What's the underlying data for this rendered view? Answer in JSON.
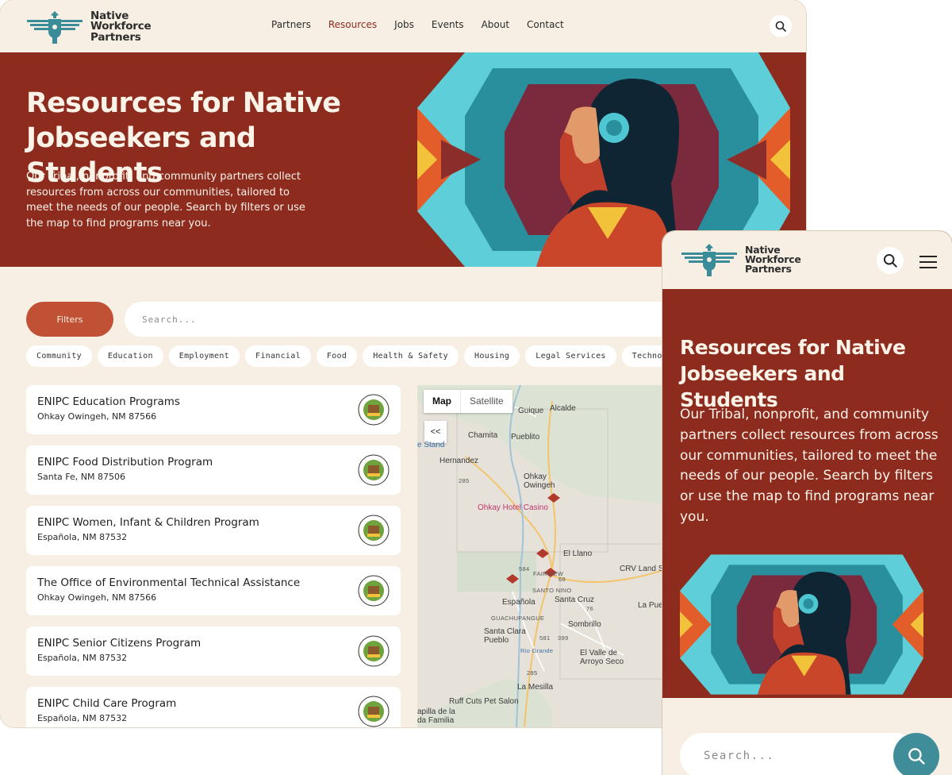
{
  "brand": {
    "name_line1": "Native",
    "name_line2": "Workforce",
    "name_line3": "Partners"
  },
  "nav": {
    "items": [
      "Partners",
      "Resources",
      "Jobs",
      "Events",
      "About",
      "Contact"
    ],
    "active": "Resources"
  },
  "hero": {
    "title": "Resources for Native Jobseekers and Students",
    "description": "Our Tribal, nonprofit, and community partners collect resources from across our communities, tailored to meet the needs of our people. Search by filters or use the map to find programs near you."
  },
  "filters": {
    "button_label": "Filters",
    "search_placeholder": "Search..."
  },
  "categories": [
    "Community",
    "Education",
    "Employment",
    "Financial",
    "Food",
    "Health & Safety",
    "Housing",
    "Legal Services",
    "Technology"
  ],
  "resources": [
    {
      "title": "ENIPC Education Programs",
      "location": "Ohkay Owingeh, NM 87566"
    },
    {
      "title": "ENIPC Food Distribution Program",
      "location": "Santa Fe, NM 87506"
    },
    {
      "title": "ENIPC Women, Infant & Children Program",
      "location": "Española, NM 87532"
    },
    {
      "title": "The Office of Environmental Technical Assistance",
      "location": "Ohkay Owingeh, NM 87566"
    },
    {
      "title": "ENIPC Senior Citizens Program",
      "location": "Española, NM 87532"
    },
    {
      "title": "ENIPC Child Care Program",
      "location": "Española, NM 87532"
    }
  ],
  "map": {
    "toggle": {
      "map": "Map",
      "satellite": "Satellite"
    },
    "collapse_label": "<<",
    "places": [
      "Guique",
      "Alcalde",
      "Chamita",
      "Pueblito",
      "e Stand",
      "Hernandez",
      "Ohkay Owingeh",
      "Ohkay Hotel Casino",
      "El Llano",
      "CRV Land Su",
      "FAIRVIEW",
      "SANTO NINO",
      "Española",
      "Santa Cruz",
      "La Pueb",
      "GUACHUPANGUE",
      "Sombrillo",
      "Santa Clara Pueblo",
      "El Valle de Arroyo Seco",
      "Rio Grande",
      "La Mesilla",
      "Ruff Cuts Pet Salon",
      "apilla de la da Familia"
    ],
    "road_shields": [
      "285",
      "584",
      "68",
      "76",
      "581",
      "399",
      "285"
    ]
  },
  "mobile": {
    "title": "Resources for Native Jobseekers and Students",
    "description": "Our Tribal, nonprofit, and community partners collect resources from across our communities, tailored to meet the needs of our people. Search by filters or use the map to find programs near you.",
    "search_placeholder": "Search..."
  },
  "colors": {
    "brand_red": "#8e2b1f",
    "cream": "#f7efe4",
    "filter_orange": "#c05134",
    "teal": "#3f8d99",
    "logo_teal": "#3a8d98"
  }
}
